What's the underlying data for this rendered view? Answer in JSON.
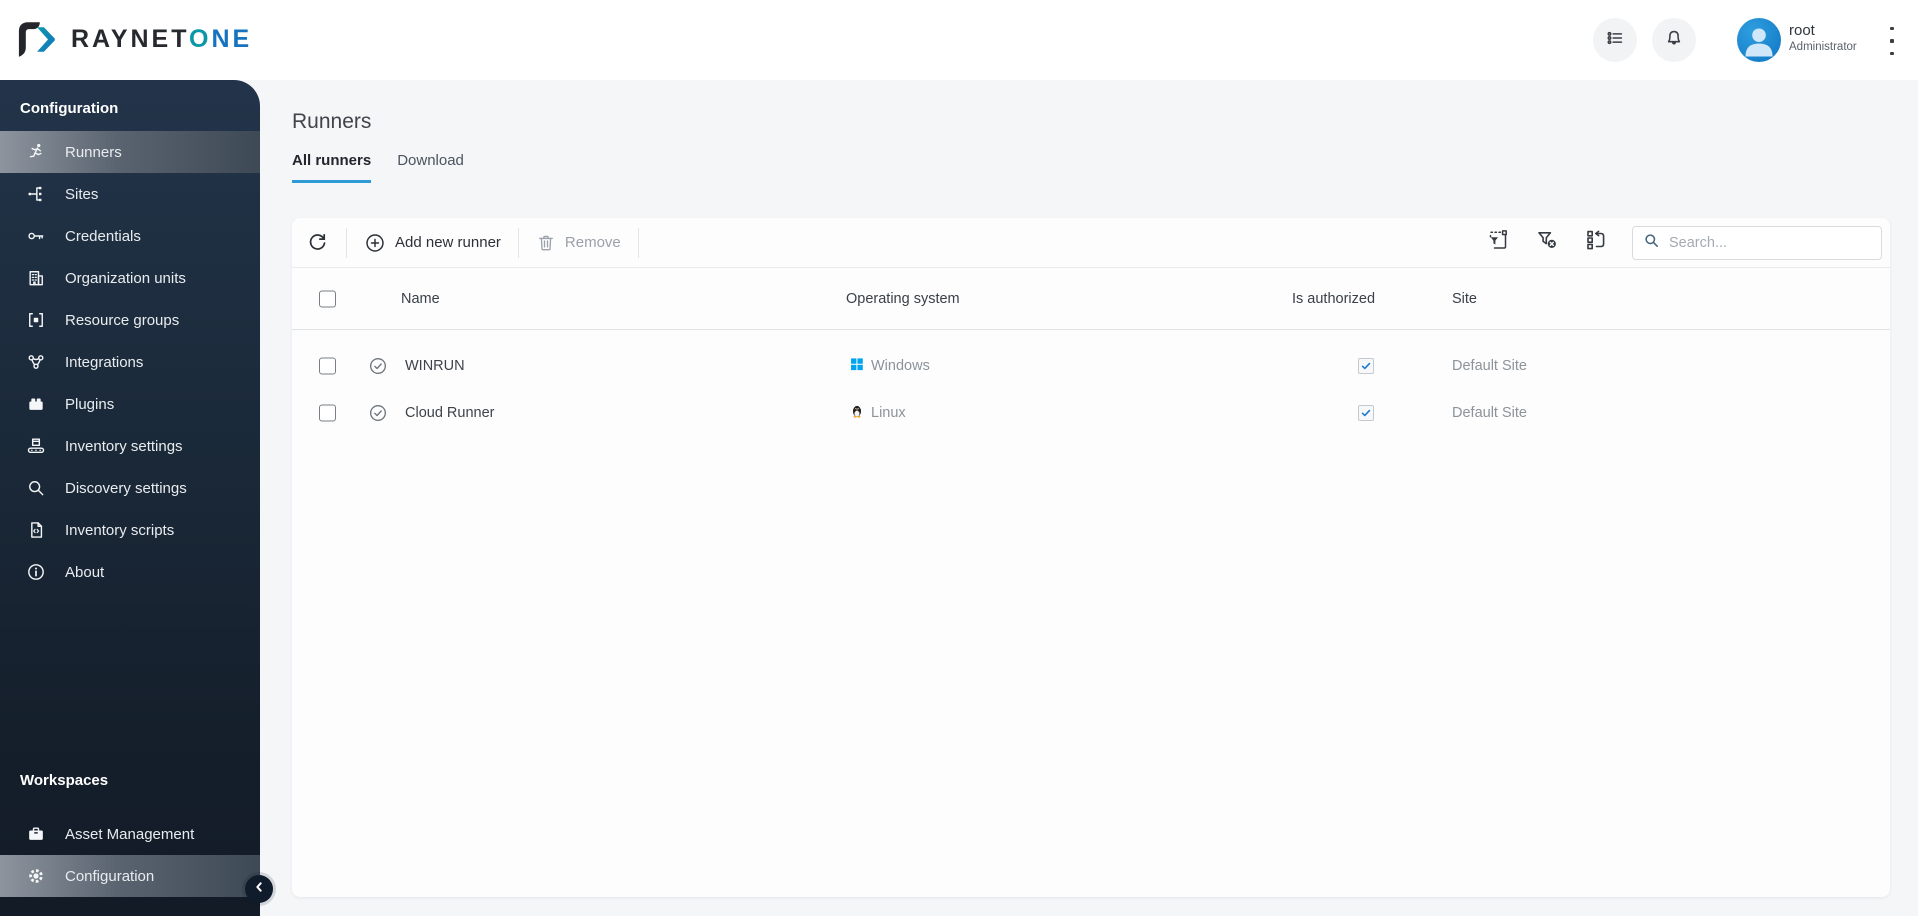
{
  "brand": {
    "name_primary": "RAYNET",
    "name_accent_o": "O",
    "name_accent_ne": "NE"
  },
  "topbar": {
    "user_name": "root",
    "user_role": "Administrator"
  },
  "sidebar": {
    "section_title": "Configuration",
    "items": [
      {
        "label": "Runners",
        "icon": "runner-icon",
        "selected": true
      },
      {
        "label": "Sites",
        "icon": "sites-icon",
        "selected": false
      },
      {
        "label": "Credentials",
        "icon": "key-icon",
        "selected": false
      },
      {
        "label": "Organization units",
        "icon": "building-icon",
        "selected": false
      },
      {
        "label": "Resource groups",
        "icon": "resource-group-icon",
        "selected": false
      },
      {
        "label": "Integrations",
        "icon": "integrations-icon",
        "selected": false
      },
      {
        "label": "Plugins",
        "icon": "plugin-icon",
        "selected": false
      },
      {
        "label": "Inventory settings",
        "icon": "conveyor-icon",
        "selected": false
      },
      {
        "label": "Discovery settings",
        "icon": "magnifier-icon",
        "selected": false
      },
      {
        "label": "Inventory scripts",
        "icon": "script-file-icon",
        "selected": false
      },
      {
        "label": "About",
        "icon": "info-icon",
        "selected": false
      }
    ],
    "workspaces_title": "Workspaces",
    "workspaces": [
      {
        "label": "Asset Management",
        "icon": "briefcase-icon",
        "selected": false
      },
      {
        "label": "Configuration",
        "icon": "gear-icon",
        "selected": true
      }
    ]
  },
  "page": {
    "title": "Runners",
    "tabs": [
      {
        "label": "All runners",
        "active": true
      },
      {
        "label": "Download",
        "active": false
      }
    ],
    "toolbar": {
      "add_label": "Add new runner",
      "remove_label": "Remove",
      "search_placeholder": "Search..."
    },
    "table": {
      "columns": [
        "Name",
        "Operating system",
        "Is authorized",
        "Site"
      ],
      "rows": [
        {
          "name": "WINRUN",
          "os": "Windows",
          "os_icon": "windows-logo",
          "authorized": true,
          "site": "Default Site"
        },
        {
          "name": "Cloud Runner",
          "os": "Linux",
          "os_icon": "linux-logo",
          "authorized": true,
          "site": "Default Site"
        }
      ]
    }
  },
  "colors": {
    "accent_blue": "#2e9bd6",
    "sidebar_bg": "#1b2a3a",
    "logo_teal": "#0a98a8",
    "logo_blue": "#1673c0",
    "avatar_blue": "#1789d6",
    "check_blue": "#1b79cf",
    "windows_blue": "#00a4ef"
  }
}
